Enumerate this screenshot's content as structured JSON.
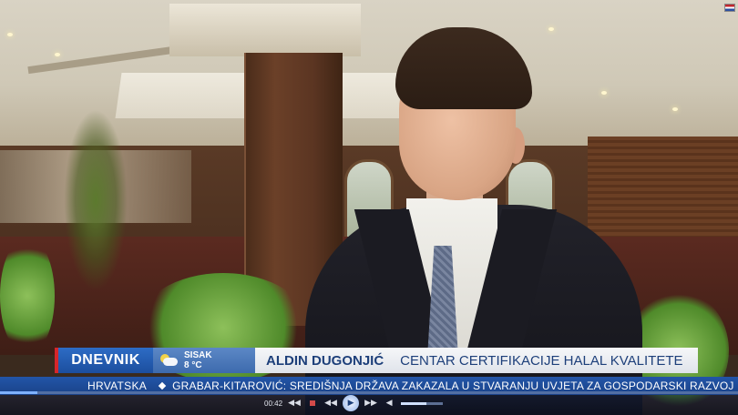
{
  "lower_third": {
    "brand": "DNEVNIK",
    "weather": {
      "city": "SISAK",
      "temperature": "8 °C",
      "icon": "sun-cloud-icon"
    },
    "guest_name": "ALDIN DUGONJIĆ",
    "guest_title": "CENTAR CERTIFIKACIJE HALAL KVALITETE"
  },
  "ticker": {
    "label": "HRVATSKA",
    "headline": "GRABAR-KITAROVIĆ: SREDIŠNJA DRŽAVA ZAKAZALA U STVARANJU UVJETA ZA GOSPODARSKI RAZVOJ"
  },
  "player": {
    "elapsed": "00:42",
    "progress": 0.05,
    "volume": 0.6,
    "icons": [
      "rewind-icon",
      "stop-icon",
      "play-icon",
      "forward-icon",
      "volume-icon"
    ]
  },
  "colors": {
    "brand_blue": "#1c4e9e",
    "ticker_blue": "#1a4288",
    "caption_text": "#1d3f7a",
    "accent_red": "#d6262b"
  }
}
